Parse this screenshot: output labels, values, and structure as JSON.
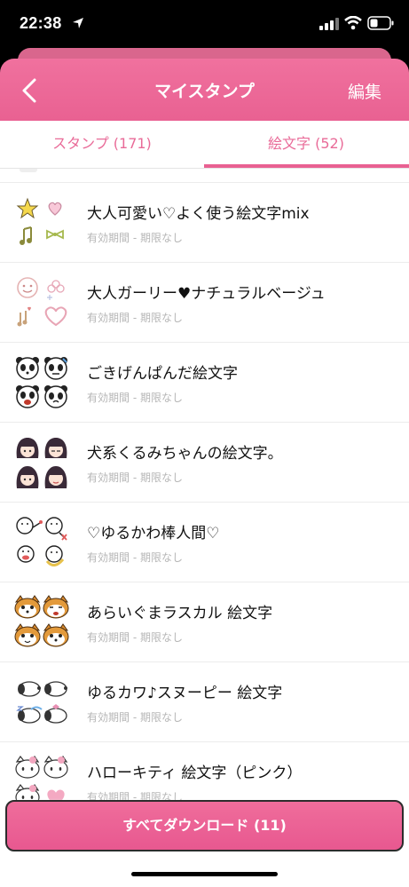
{
  "status_bar": {
    "time": "22:38"
  },
  "header": {
    "title": "マイスタンプ",
    "edit_label": "編集"
  },
  "tabs": [
    {
      "label": "スタンプ (171)",
      "selected": false
    },
    {
      "label": "絵文字 (52)",
      "selected": true
    }
  ],
  "items": [
    {
      "title": "大人可愛い♡よく使う絵文字mix",
      "subtitle": "有効期間 - 期限なし",
      "icon": "star-heart-music-ribbon-icon"
    },
    {
      "title": "大人ガーリー♥ナチュラルベージュ",
      "subtitle": "有効期間 - 期限なし",
      "icon": "smile-flower-heart-icon"
    },
    {
      "title": "ごきげんぱんだ絵文字",
      "subtitle": "有効期間 - 期限なし",
      "icon": "panda-icon"
    },
    {
      "title": "犬系くるみちゃんの絵文字。",
      "subtitle": "有効期間 - 期限なし",
      "icon": "girl-icon"
    },
    {
      "title": "♡ゆるかわ棒人間♡",
      "subtitle": "有効期間 - 期限なし",
      "icon": "stick-figure-icon"
    },
    {
      "title": "あらいぐまラスカル 絵文字",
      "subtitle": "有効期間 - 期限なし",
      "icon": "raccoon-icon"
    },
    {
      "title": "ゆるカワ♪スヌーピー 絵文字",
      "subtitle": "有効期間 - 期限なし",
      "icon": "snoopy-icon"
    },
    {
      "title": "ハローキティ 絵文字（ピンク）",
      "subtitle": "有効期間 - 期限なし",
      "icon": "hello-kitty-icon"
    }
  ],
  "download": {
    "label": "すべてダウンロード (11)"
  },
  "colors": {
    "accent": "#e96192",
    "tab_text": "#e96b98",
    "subtitle": "#b6b6b6"
  }
}
